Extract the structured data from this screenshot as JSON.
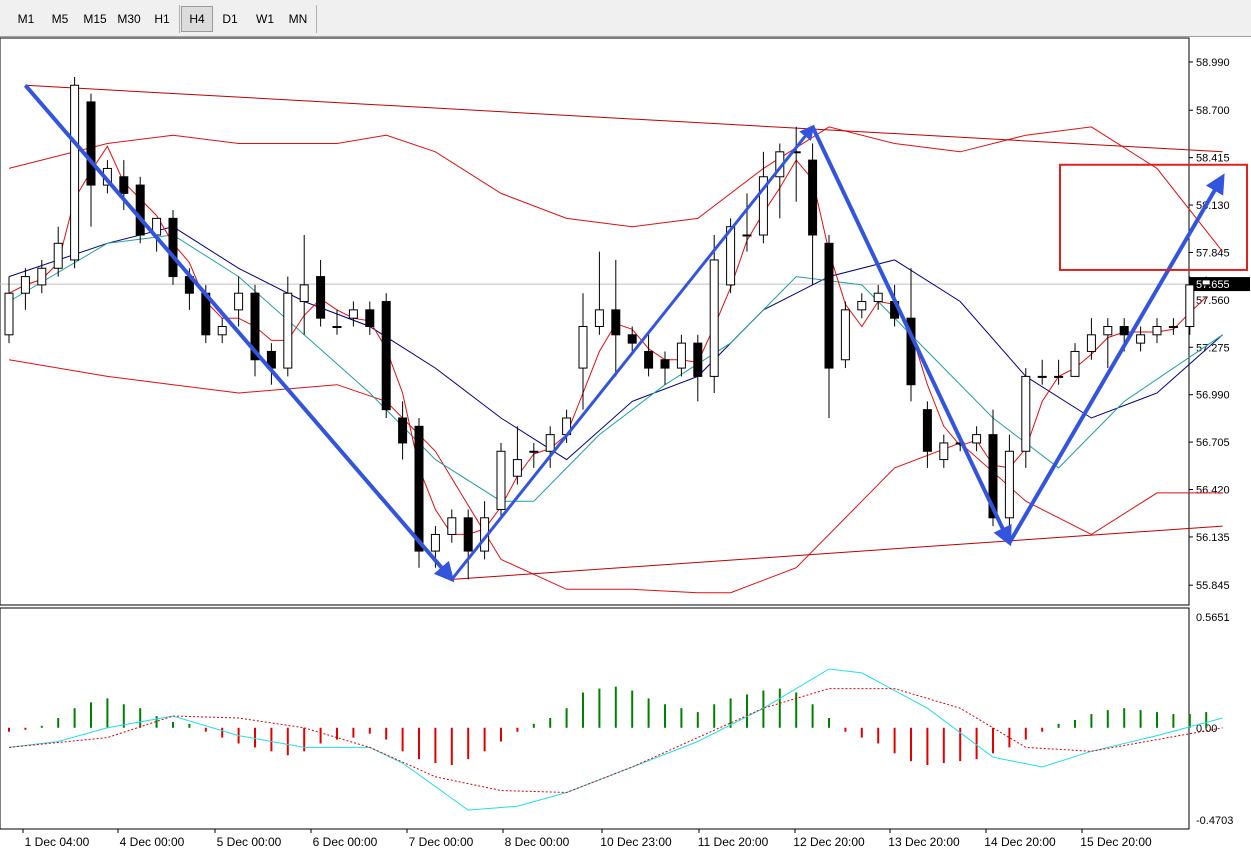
{
  "toolbar": {
    "timeframes": [
      "M1",
      "M5",
      "M15",
      "M30",
      "H1",
      "H4",
      "D1",
      "W1",
      "MN"
    ],
    "active": "H4"
  },
  "colors": {
    "bull_candle": "#ffffff",
    "bear_candle": "#000000",
    "bands": "#e01010",
    "ma_navy": "#000080",
    "ma_teal": "#20a0a0",
    "trend": "#c00000",
    "arrow": "#3355dd",
    "highlight_box": "#e02020",
    "hist_up": "#008000",
    "hist_down": "#e00000",
    "signal_cyan": "#20e0e8",
    "signal_dotted": "#e00000"
  },
  "chart_data": [
    {
      "type": "candlestick",
      "ylim": [
        55.78,
        59.08
      ],
      "y_ticks": [
        "58.990",
        "58.700",
        "58.415",
        "58.130",
        "57.845",
        "57.560",
        "57.275",
        "56.990",
        "56.705",
        "56.420",
        "56.135",
        "55.845"
      ],
      "current_price": "57.655",
      "x_ticks": [
        "1 Dec 04:00",
        "4 Dec 00:00",
        "5 Dec 00:00",
        "6 Dec 00:00",
        "7 Dec 00:00",
        "8 Dec 00:00",
        "10 Dec 23:00",
        "11 Dec 20:00",
        "12 Dec 20:00",
        "13 Dec 20:00",
        "14 Dec 20:00",
        "15 Dec 20:00"
      ],
      "candles": [
        [
          57.35,
          57.6,
          57.7,
          57.3
        ],
        [
          57.6,
          57.7,
          57.75,
          57.5
        ],
        [
          57.65,
          57.75,
          57.8,
          57.6
        ],
        [
          57.75,
          57.9,
          58.0,
          57.7
        ],
        [
          57.8,
          58.85,
          58.9,
          57.75
        ],
        [
          58.75,
          58.25,
          58.8,
          58.0
        ],
        [
          58.25,
          58.35,
          58.4,
          58.2
        ],
        [
          58.3,
          58.2,
          58.4,
          58.1
        ],
        [
          58.25,
          57.95,
          58.3,
          57.9
        ],
        [
          57.95,
          58.05,
          58.05,
          57.85
        ],
        [
          58.05,
          57.7,
          58.1,
          57.65
        ],
        [
          57.7,
          57.6,
          57.75,
          57.5
        ],
        [
          57.6,
          57.35,
          57.65,
          57.3
        ],
        [
          57.35,
          57.4,
          57.45,
          57.3
        ],
        [
          57.5,
          57.6,
          57.7,
          57.4
        ],
        [
          57.6,
          57.2,
          57.65,
          57.1
        ],
        [
          57.25,
          57.15,
          57.3,
          57.05
        ],
        [
          57.15,
          57.6,
          57.7,
          57.1
        ],
        [
          57.55,
          57.65,
          57.95,
          57.35
        ],
        [
          57.7,
          57.45,
          57.8,
          57.4
        ],
        [
          57.4,
          57.4,
          57.5,
          57.35
        ],
        [
          57.45,
          57.5,
          57.55,
          57.4
        ],
        [
          57.5,
          57.4,
          57.55,
          57.35
        ],
        [
          57.55,
          56.9,
          57.6,
          56.85
        ],
        [
          56.85,
          56.7,
          56.95,
          56.6
        ],
        [
          56.8,
          56.05,
          56.85,
          55.95
        ],
        [
          56.05,
          56.15,
          56.2,
          55.95
        ],
        [
          56.15,
          56.25,
          56.3,
          56.1
        ],
        [
          56.25,
          56.05,
          56.3,
          55.88
        ],
        [
          56.05,
          56.25,
          56.35,
          56.0
        ],
        [
          56.3,
          56.65,
          56.7,
          56.25
        ],
        [
          56.5,
          56.6,
          56.8,
          56.45
        ],
        [
          56.65,
          56.65,
          56.7,
          56.55
        ],
        [
          56.65,
          56.75,
          56.8,
          56.55
        ],
        [
          56.75,
          56.85,
          56.9,
          56.7
        ],
        [
          57.15,
          57.4,
          57.6,
          56.9
        ],
        [
          57.4,
          57.5,
          57.85,
          57.35
        ],
        [
          57.5,
          57.35,
          57.8,
          57.1
        ],
        [
          57.35,
          57.3,
          57.4,
          57.25
        ],
        [
          57.25,
          57.15,
          57.35,
          57.1
        ],
        [
          57.2,
          57.15,
          57.25,
          57.05
        ],
        [
          57.15,
          57.3,
          57.35,
          57.1
        ],
        [
          57.3,
          57.1,
          57.35,
          56.95
        ],
        [
          57.1,
          57.8,
          57.95,
          57.0
        ],
        [
          57.65,
          58.0,
          58.05,
          57.6
        ],
        [
          57.95,
          57.95,
          58.2,
          57.85
        ],
        [
          57.95,
          58.3,
          58.45,
          57.9
        ],
        [
          58.3,
          58.45,
          58.5,
          58.05
        ],
        [
          58.45,
          58.45,
          58.6,
          58.15
        ],
        [
          58.4,
          57.95,
          58.5,
          57.65
        ],
        [
          57.9,
          57.15,
          57.95,
          56.85
        ],
        [
          57.2,
          57.5,
          57.55,
          57.15
        ],
        [
          57.5,
          57.55,
          57.6,
          57.45
        ],
        [
          57.55,
          57.6,
          57.65,
          57.5
        ],
        [
          57.55,
          57.45,
          57.65,
          57.4
        ],
        [
          57.45,
          57.05,
          57.75,
          56.95
        ],
        [
          56.9,
          56.65,
          56.95,
          56.55
        ],
        [
          56.6,
          56.7,
          56.75,
          56.55
        ],
        [
          56.7,
          56.7,
          56.75,
          56.65
        ],
        [
          56.7,
          56.75,
          56.8,
          56.65
        ],
        [
          56.75,
          56.25,
          56.9,
          56.2
        ],
        [
          56.25,
          56.65,
          56.75,
          56.2
        ],
        [
          56.65,
          57.1,
          57.15,
          56.55
        ],
        [
          57.1,
          57.1,
          57.2,
          57.05
        ],
        [
          57.1,
          57.1,
          57.2,
          57.05
        ],
        [
          57.1,
          57.25,
          57.3,
          57.1
        ],
        [
          57.25,
          57.35,
          57.45,
          57.2
        ],
        [
          57.35,
          57.4,
          57.45,
          57.15
        ],
        [
          57.4,
          57.35,
          57.45,
          57.25
        ],
        [
          57.3,
          57.35,
          57.4,
          57.25
        ],
        [
          57.35,
          57.4,
          57.45,
          57.3
        ],
        [
          57.4,
          57.4,
          57.45,
          57.35
        ],
        [
          57.4,
          57.65,
          57.7,
          57.35
        ],
        [
          57.65,
          57.68,
          57.7,
          57.62
        ]
      ],
      "bb_upper": [
        [
          0,
          58.35
        ],
        [
          6,
          58.5
        ],
        [
          10,
          58.55
        ],
        [
          14,
          58.5
        ],
        [
          20,
          58.5
        ],
        [
          23,
          58.55
        ],
        [
          26,
          58.45
        ],
        [
          30,
          58.2
        ],
        [
          34,
          58.05
        ],
        [
          38,
          58.0
        ],
        [
          42,
          58.05
        ],
        [
          46,
          58.35
        ],
        [
          50,
          58.6
        ],
        [
          54,
          58.5
        ],
        [
          58,
          58.45
        ],
        [
          62,
          58.55
        ],
        [
          66,
          58.6
        ],
        [
          70,
          58.35
        ],
        [
          74,
          57.85
        ]
      ],
      "bb_middle": [
        [
          0,
          57.7
        ],
        [
          6,
          57.9
        ],
        [
          10,
          58.0
        ],
        [
          14,
          57.75
        ],
        [
          18,
          57.55
        ],
        [
          22,
          57.4
        ],
        [
          26,
          57.15
        ],
        [
          30,
          56.85
        ],
        [
          34,
          56.6
        ],
        [
          38,
          56.95
        ],
        [
          42,
          57.1
        ],
        [
          46,
          57.5
        ],
        [
          50,
          57.7
        ],
        [
          54,
          57.8
        ],
        [
          58,
          57.55
        ],
        [
          62,
          57.1
        ],
        [
          66,
          56.85
        ],
        [
          70,
          57.0
        ],
        [
          74,
          57.35
        ]
      ],
      "bb_lower": [
        [
          0,
          57.2
        ],
        [
          6,
          57.1
        ],
        [
          10,
          57.05
        ],
        [
          14,
          57.0
        ],
        [
          20,
          57.05
        ],
        [
          23,
          56.95
        ],
        [
          26,
          56.65
        ],
        [
          30,
          56.0
        ],
        [
          34,
          55.82
        ],
        [
          38,
          55.82
        ],
        [
          42,
          55.8
        ],
        [
          44,
          55.8
        ],
        [
          48,
          55.95
        ],
        [
          52,
          56.35
        ],
        [
          54,
          56.55
        ],
        [
          58,
          56.7
        ],
        [
          62,
          56.35
        ],
        [
          66,
          56.15
        ],
        [
          70,
          56.4
        ],
        [
          74,
          56.4
        ]
      ],
      "ma_navy": [
        [
          0,
          57.65
        ],
        [
          8,
          57.8
        ],
        [
          14,
          57.7
        ],
        [
          18,
          57.55
        ],
        [
          22,
          57.35
        ],
        [
          26,
          57.05
        ],
        [
          30,
          56.8
        ],
        [
          34,
          56.75
        ],
        [
          38,
          56.7
        ],
        [
          42,
          56.75
        ],
        [
          46,
          57.1
        ],
        [
          48,
          57.3
        ],
        [
          52,
          57.55
        ],
        [
          56,
          57.5
        ],
        [
          60,
          57.3
        ],
        [
          64,
          57.25
        ],
        [
          66,
          57.1
        ],
        [
          70,
          56.95
        ],
        [
          74,
          56.95
        ]
      ],
      "ma_teal": [
        [
          0,
          57.55
        ],
        [
          6,
          57.9
        ],
        [
          10,
          57.95
        ],
        [
          14,
          57.7
        ],
        [
          18,
          57.35
        ],
        [
          22,
          57.0
        ],
        [
          26,
          56.6
        ],
        [
          30,
          56.35
        ],
        [
          32,
          56.35
        ],
        [
          36,
          56.75
        ],
        [
          40,
          57.05
        ],
        [
          44,
          57.3
        ],
        [
          48,
          57.7
        ],
        [
          52,
          57.65
        ],
        [
          56,
          57.25
        ],
        [
          60,
          56.85
        ],
        [
          64,
          56.55
        ],
        [
          68,
          56.95
        ],
        [
          74,
          57.35
        ]
      ],
      "trendlines": [
        [
          [
            1,
            58.85
          ],
          [
            74,
            58.45
          ]
        ],
        [
          [
            27,
            55.88
          ],
          [
            74,
            56.2
          ]
        ]
      ],
      "arrows": [
        [
          [
            1,
            58.85
          ],
          [
            27,
            55.88
          ]
        ],
        [
          [
            27,
            55.88
          ],
          [
            49,
            58.6
          ]
        ],
        [
          [
            49,
            58.6
          ],
          [
            61,
            56.1
          ]
        ],
        [
          [
            61,
            56.1
          ],
          [
            74,
            58.3
          ]
        ]
      ],
      "highlight_box": [
        [
          65,
          74
        ],
        [
          57.8,
          58.3
        ]
      ]
    },
    {
      "type": "bar",
      "ylim": [
        -0.4703,
        0.5651
      ],
      "y_ticks": [
        "0.5651",
        "0.00",
        "-0.4703"
      ],
      "histogram": [
        -0.02,
        -0.01,
        0.01,
        0.05,
        0.1,
        0.13,
        0.15,
        0.12,
        0.1,
        0.06,
        0.03,
        0.02,
        -0.02,
        -0.05,
        -0.08,
        -0.1,
        -0.12,
        -0.14,
        -0.12,
        -0.08,
        -0.06,
        -0.05,
        -0.03,
        -0.06,
        -0.12,
        -0.16,
        -0.18,
        -0.19,
        -0.16,
        -0.12,
        -0.07,
        -0.02,
        0.02,
        0.05,
        0.1,
        0.18,
        0.2,
        0.21,
        0.19,
        0.15,
        0.12,
        0.1,
        0.08,
        0.12,
        0.15,
        0.17,
        0.19,
        0.2,
        0.18,
        0.12,
        0.05,
        -0.02,
        -0.05,
        -0.08,
        -0.13,
        -0.17,
        -0.19,
        -0.18,
        -0.17,
        -0.16,
        -0.13,
        -0.1,
        -0.06,
        -0.02,
        0.02,
        0.04,
        0.07,
        0.09,
        0.1,
        0.09,
        0.08,
        0.07,
        0.07,
        0.08
      ],
      "signal_cyan": [
        [
          0,
          -0.1
        ],
        [
          3,
          -0.07
        ],
        [
          6,
          0.0
        ],
        [
          10,
          0.06
        ],
        [
          14,
          -0.04
        ],
        [
          18,
          -0.1
        ],
        [
          22,
          -0.1
        ],
        [
          24,
          -0.18
        ],
        [
          28,
          -0.42
        ],
        [
          31,
          -0.4
        ],
        [
          34,
          -0.33
        ],
        [
          38,
          -0.2
        ],
        [
          42,
          -0.07
        ],
        [
          46,
          0.1
        ],
        [
          50,
          0.3
        ],
        [
          52,
          0.28
        ],
        [
          56,
          0.1
        ],
        [
          60,
          -0.15
        ],
        [
          63,
          -0.2
        ],
        [
          66,
          -0.12
        ],
        [
          70,
          -0.04
        ],
        [
          74,
          0.05
        ]
      ],
      "signal_dotted": [
        [
          0,
          -0.1
        ],
        [
          6,
          -0.05
        ],
        [
          10,
          0.06
        ],
        [
          14,
          0.05
        ],
        [
          18,
          0.0
        ],
        [
          22,
          -0.1
        ],
        [
          26,
          -0.25
        ],
        [
          30,
          -0.32
        ],
        [
          34,
          -0.33
        ],
        [
          38,
          -0.2
        ],
        [
          42,
          -0.05
        ],
        [
          46,
          0.1
        ],
        [
          50,
          0.2
        ],
        [
          54,
          0.2
        ],
        [
          58,
          0.1
        ],
        [
          62,
          -0.1
        ],
        [
          66,
          -0.12
        ],
        [
          70,
          -0.06
        ],
        [
          74,
          0.0
        ]
      ]
    }
  ]
}
